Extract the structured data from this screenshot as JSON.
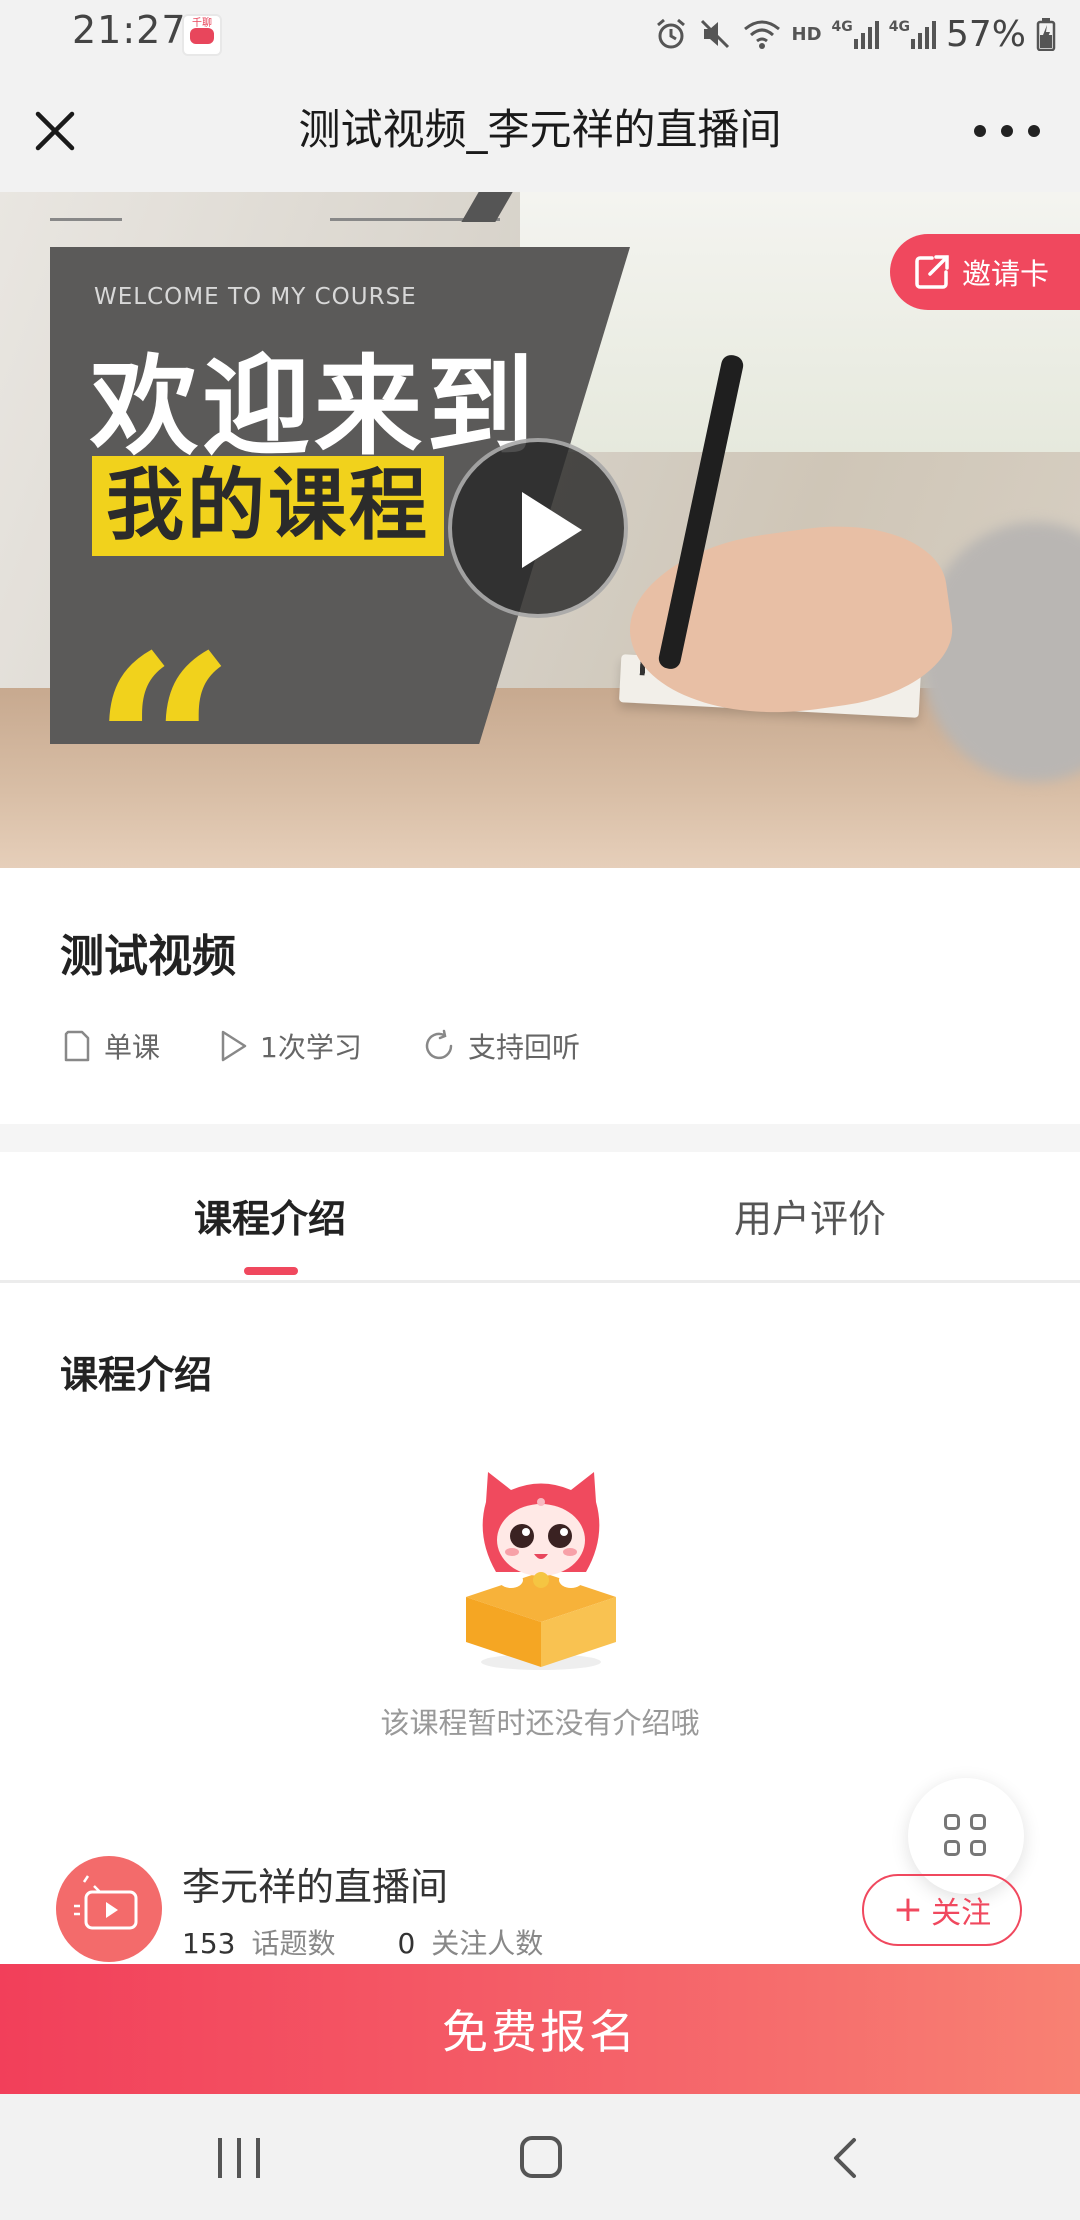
{
  "status_bar": {
    "time": "21:27",
    "app_icon_text": "千聊",
    "icons": [
      "alarm-icon",
      "mute-icon",
      "wifi-icon",
      "hd-icon",
      "signal-4g-icon",
      "signal-4g-icon"
    ],
    "hd": "HD",
    "net": "4G",
    "battery": "57%"
  },
  "header": {
    "title": "测试视频_李元祥的直播间",
    "close_icon": "close-icon",
    "more_icon": "more-icon"
  },
  "hero": {
    "small_text": "WELCOME TO MY COURSE",
    "big_text": "欢迎来到",
    "highlight_text": "我的课程",
    "quote_mark": "“",
    "invite_label": "邀请卡"
  },
  "course": {
    "title": "测试视频",
    "meta": [
      {
        "icon": "document-icon",
        "label": "单课"
      },
      {
        "icon": "play-outline-icon",
        "label": "1次学习"
      },
      {
        "icon": "replay-icon",
        "label": "支持回听"
      }
    ]
  },
  "tabs": [
    {
      "label": "课程介绍",
      "active": true
    },
    {
      "label": "用户评价",
      "active": false
    }
  ],
  "intro": {
    "section_title": "课程介绍",
    "empty_text": "该课程暂时还没有介绍哦"
  },
  "host": {
    "name": "李元祥的直播间",
    "topics_count": "153",
    "topics_label": "话题数",
    "followers_count": "0",
    "followers_label": "关注人数",
    "follow_label": "关注"
  },
  "register_label": "免费报名",
  "colors": {
    "accent": "#f0485e",
    "highlight_yellow": "#f1d21c"
  }
}
